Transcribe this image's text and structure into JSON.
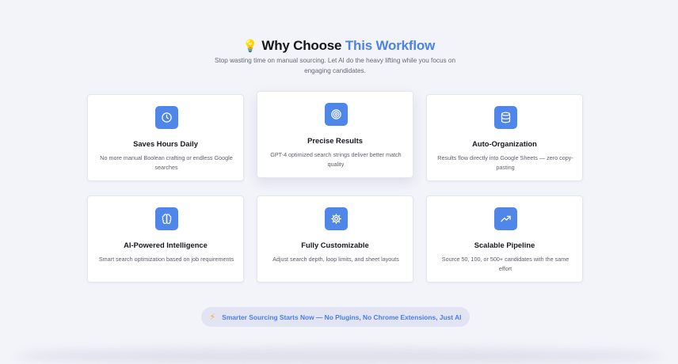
{
  "header": {
    "emoji": "💡",
    "title_part1": "Why Choose ",
    "title_accent": "This Workflow",
    "subtitle": "Stop wasting time on manual sourcing. Let AI do the heavy lifting while you focus on engaging candidates."
  },
  "cards": [
    {
      "icon": "clock-icon",
      "title": "Saves Hours Daily",
      "desc": "No more manual Boolean crafting or endless Google searches"
    },
    {
      "icon": "target-icon",
      "title": "Precise Results",
      "desc": "GPT-4 optimized search strings deliver better match quality"
    },
    {
      "icon": "database-icon",
      "title": "Auto-Organization",
      "desc": "Results flow directly into Google Sheets — zero copy-pasting"
    },
    {
      "icon": "brain-icon",
      "title": "AI-Powered Intelligence",
      "desc": "Smart search optimization based on job requirements"
    },
    {
      "icon": "gear-icon",
      "title": "Fully Customizable",
      "desc": "Adjust search depth, loop limits, and sheet layouts"
    },
    {
      "icon": "trending-up-icon",
      "title": "Scalable Pipeline",
      "desc": "Source 50, 100, or 500+ candidates with the same effort"
    }
  ],
  "banner": {
    "emoji": "⚡",
    "text": "Smarter Sourcing Starts Now — No Plugins, No Chrome Extensions, Just AI"
  },
  "colors": {
    "accent": "#4b83e6",
    "icon_bg": "#4f86ea",
    "background": "#f3f3fa",
    "banner_bg": "#e2e4f4"
  }
}
